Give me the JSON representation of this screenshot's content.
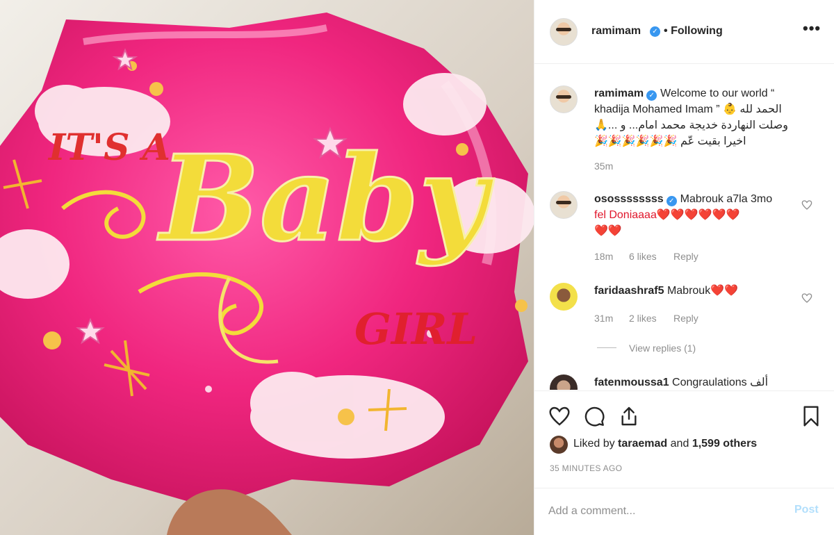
{
  "post": {
    "username": "ramimam",
    "follow_status": "Following",
    "more_label": "•••",
    "dot_separator": "•"
  },
  "caption": {
    "username": "ramimam",
    "line1": "Welcome to our world “",
    "line2": "khadija Mohamed Imam ” 👶 الحمد لله",
    "line3": "🙏... وصلت النهاردة خديجة محمد امام... و",
    "line4": "🎉🎉🎉🎉🎉🎉 اخيرا بقيت عّم",
    "time": "35m"
  },
  "comments": [
    {
      "username": "osossssssss",
      "verified": true,
      "line1": "Mabrouk a7la 3mo",
      "line2": "fel Doniaaaa❤️❤️❤️❤️❤️❤️",
      "line3": "❤️❤️",
      "time": "18m",
      "likes": "6 likes",
      "reply": "Reply"
    },
    {
      "username": "faridaashraf5",
      "text": "Mabrouk❤️❤️",
      "time": "31m",
      "likes": "2 likes",
      "reply": "Reply",
      "view_replies": "View replies (1)"
    },
    {
      "username": "fatenmoussa1",
      "text": "Congraulations ألف"
    }
  ],
  "actions": {
    "liked_prefix": "Liked by",
    "liked_user": "taraemad",
    "liked_and": "and",
    "liked_count": "1,599 others",
    "time_ago": "35 MINUTES AGO"
  },
  "composer": {
    "placeholder": "Add a comment...",
    "post_label": "Post"
  },
  "image": {
    "balloon_text_1": "IT'S A",
    "balloon_text_2": "Baby",
    "balloon_text_3": "GIRL"
  },
  "colors": {
    "verified": "#3897f0",
    "balloon_pink": "#f0267f",
    "post_disabled": "#b2dffc"
  }
}
